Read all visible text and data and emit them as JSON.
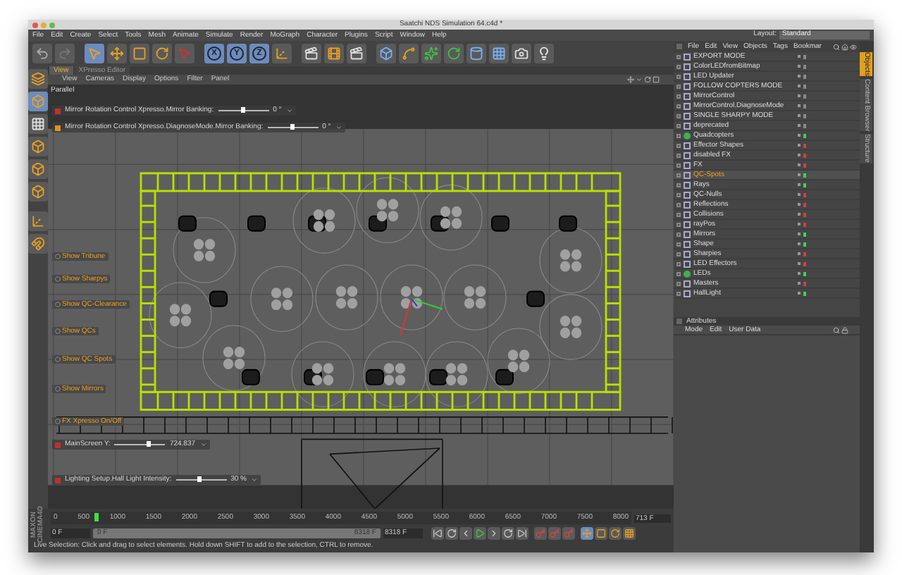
{
  "window": {
    "title": "Saatchi NDS Simulation 64.c4d *"
  },
  "menu_bar": [
    "File",
    "Edit",
    "Create",
    "Select",
    "Tools",
    "Mesh",
    "Animate",
    "Simulate",
    "Render",
    "MoGraph",
    "Character",
    "Plugins",
    "Script",
    "Window",
    "Help"
  ],
  "layout": {
    "label": "Layout:",
    "value": "Standard"
  },
  "toolbar": {
    "axis_buttons": [
      {
        "label": "X",
        "selected": true
      },
      {
        "label": "Y",
        "selected": true
      },
      {
        "label": "Z",
        "selected": true
      }
    ]
  },
  "viewport": {
    "tabs": [
      {
        "label": "View",
        "selected": true
      },
      {
        "label": "XPresso Editor",
        "selected": false
      }
    ],
    "menu": [
      "View",
      "Cameras",
      "Display",
      "Options",
      "Filter",
      "Panel"
    ],
    "projection": "Parallel",
    "hud": [
      {
        "kind": "slider",
        "label": "Mirror Rotation Control Xpresso.Mirror Banking:",
        "level": 0.5,
        "value": "0 °"
      },
      {
        "kind": "slider",
        "label": "Mirror Rotation Control Xpresso.DiagnoseMode.Mirror Banking:",
        "level": 0.5,
        "value": "0 °"
      },
      {
        "kind": "button",
        "label": "Show Tribune"
      },
      {
        "kind": "button",
        "label": "Show Sharpys"
      },
      {
        "kind": "button",
        "label": "Show QC-Clearance"
      },
      {
        "kind": "button",
        "label": "Show QCs"
      },
      {
        "kind": "button",
        "label": "Show QC Spots"
      },
      {
        "kind": "button",
        "label": "Show Mirrors"
      },
      {
        "kind": "button",
        "label": "FX Xpresso On/Off"
      },
      {
        "kind": "slider",
        "label": "MainScreen Y:",
        "level": 0.68,
        "value": "724.837"
      },
      {
        "kind": "slider",
        "label": "Lighting Setup.Hall Light Intensity:",
        "level": 0.47,
        "value": "30 %"
      }
    ]
  },
  "objects_panel": {
    "menu": [
      "File",
      "Edit",
      "View",
      "Objects",
      "Tags",
      "Bookmar"
    ],
    "items": [
      {
        "name": "EXPORT MODE",
        "kind": "null",
        "selected": false,
        "color": "#8a8a8a"
      },
      {
        "name": "ColorLEDfromBitmap",
        "kind": "null",
        "selected": false,
        "color": "#8a8a8a"
      },
      {
        "name": "LED Updater",
        "kind": "null",
        "selected": false,
        "color": "#8a8a8a"
      },
      {
        "name": "FOLLOW COPTERS MODE",
        "kind": "null",
        "selected": false,
        "color": "#8a8a8a"
      },
      {
        "name": "MirrorControl",
        "kind": "null",
        "selected": false,
        "color": "#8a8a8a"
      },
      {
        "name": "MirrorControl.DiagnoseMode",
        "kind": "null",
        "selected": false,
        "color": "#8a8a8a"
      },
      {
        "name": "SINGLE SHARPY MODE",
        "kind": "null",
        "selected": false,
        "color": "#8a8a8a"
      },
      {
        "name": "deprecated",
        "kind": "null",
        "selected": false,
        "color": "#8a8a8a"
      },
      {
        "name": "Quadcopters",
        "kind": "cloner",
        "selected": false,
        "color": "#3ed05a"
      },
      {
        "name": "Effector Shapes",
        "kind": "null",
        "selected": false,
        "color": "#d04040"
      },
      {
        "name": "disabled FX",
        "kind": "null",
        "selected": false,
        "color": "#d04040"
      },
      {
        "name": "FX",
        "kind": "null",
        "selected": false,
        "color": "#d04040"
      },
      {
        "name": "QC-Spots",
        "kind": "null",
        "selected": true,
        "color": "#3ed05a"
      },
      {
        "name": "Rays",
        "kind": "null",
        "selected": false,
        "color": "#3ed05a"
      },
      {
        "name": "QC-Nulls",
        "kind": "null",
        "selected": false,
        "color": "#d04040"
      },
      {
        "name": "Reflections",
        "kind": "null",
        "selected": false,
        "color": "#d04040"
      },
      {
        "name": "Collisions",
        "kind": "null",
        "selected": false,
        "color": "#d04040"
      },
      {
        "name": "rayPos",
        "kind": "null",
        "selected": false,
        "color": "#d04040"
      },
      {
        "name": "Mirrors",
        "kind": "null",
        "selected": false,
        "color": "#3ed05a"
      },
      {
        "name": "Shape",
        "kind": "null",
        "selected": false,
        "color": "#3ed05a"
      },
      {
        "name": "Sharpies",
        "kind": "null",
        "selected": false,
        "color": "#d04040"
      },
      {
        "name": "LED Effectors",
        "kind": "null",
        "selected": false,
        "color": "#d04040"
      },
      {
        "name": "LEDs",
        "kind": "cloner",
        "selected": false,
        "color": "#3ed05a"
      },
      {
        "name": "Masters",
        "kind": "null",
        "selected": false,
        "color": "#d04040"
      },
      {
        "name": "HallLight",
        "kind": "null",
        "selected": false,
        "color": "#3ed05a"
      }
    ],
    "side_tabs": [
      {
        "label": "Objects",
        "selected": true
      },
      {
        "label": "Content Browser",
        "selected": false
      },
      {
        "label": "Structure",
        "selected": false
      }
    ]
  },
  "attributes_panel": {
    "title": "Attributes",
    "menu": [
      "Mode",
      "Edit",
      "User Data"
    ]
  },
  "timeline": {
    "logo": [
      "MAXON",
      "CINEMA4D"
    ],
    "ticks": [
      "0",
      "500",
      "1000",
      "1500",
      "2000",
      "2500",
      "3000",
      "3500",
      "4000",
      "4500",
      "5000",
      "5500",
      "6000",
      "6500",
      "7000",
      "7500",
      "8000"
    ],
    "current_frame": "713 F",
    "start_field": "0 F",
    "range": {
      "start": "0 F",
      "end": "8318 F",
      "level": 1
    },
    "end_field": "8318 F"
  },
  "status_bar": "Live Selection: Click and drag to select elements. Hold down SHIFT to add to the selection, CTRL to remove."
}
